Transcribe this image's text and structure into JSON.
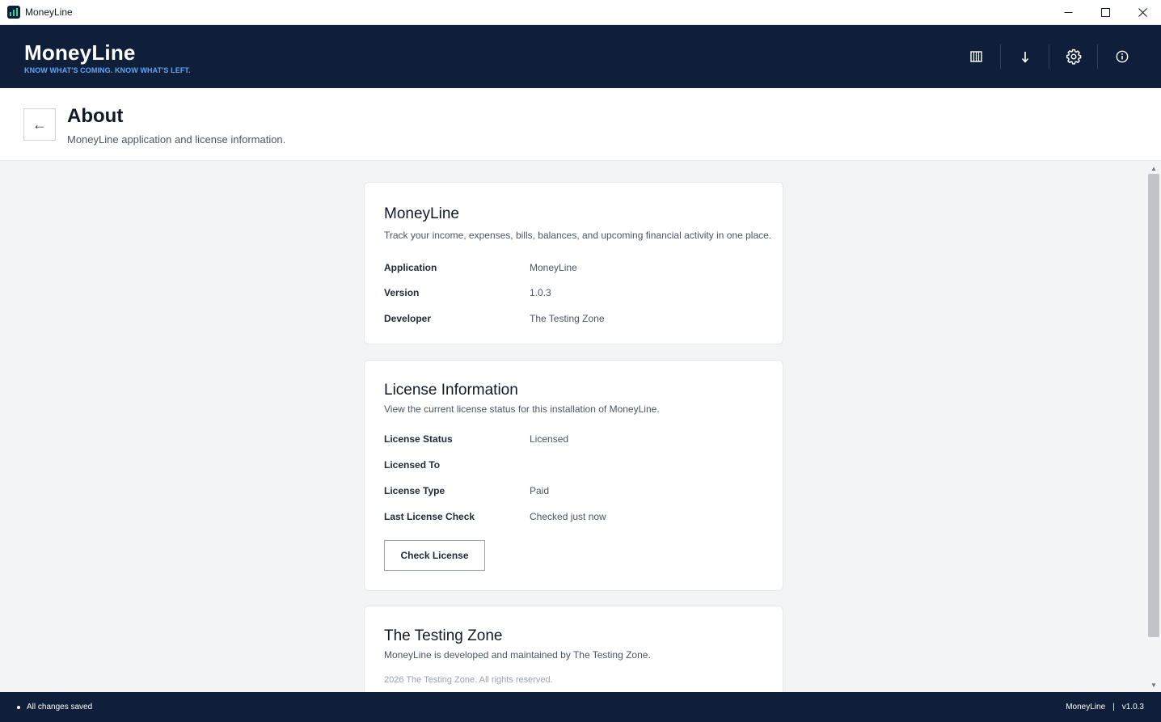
{
  "window": {
    "title": "MoneyLine",
    "controls": {
      "minimize": "—",
      "maximize": "☐",
      "close": "✕"
    }
  },
  "header": {
    "brand_name": "MoneyLine",
    "tagline": "KNOW WHAT'S COMING. KNOW WHAT'S LEFT.",
    "actions": [
      {
        "icon": "columns-icon"
      },
      {
        "icon": "download-icon"
      },
      {
        "icon": "gear-icon"
      },
      {
        "icon": "info-icon"
      }
    ]
  },
  "page": {
    "back_icon": "←",
    "title": "About",
    "subtitle": "MoneyLine application and license information."
  },
  "app_card": {
    "title": "MoneyLine",
    "description": "Track your income, expenses, bills, balances, and upcoming financial activity in one place.",
    "rows": [
      {
        "label": "Application",
        "value": "MoneyLine"
      },
      {
        "label": "Version",
        "value": "1.0.3"
      },
      {
        "label": "Developer",
        "value": "The Testing Zone"
      }
    ]
  },
  "license_card": {
    "title": "License Information",
    "description": "View the current license status for this installation of MoneyLine.",
    "rows": [
      {
        "label": "License Status",
        "value": "Licensed"
      },
      {
        "label": "Licensed To",
        "value": ""
      },
      {
        "label": "License Type",
        "value": "Paid"
      },
      {
        "label": "Last License Check",
        "value": "Checked just now"
      }
    ],
    "check_button": "Check License"
  },
  "company_card": {
    "title": "The Testing Zone",
    "description": "MoneyLine is developed and maintained by The Testing Zone.",
    "copyright": "2026 The Testing Zone. All rights reserved."
  },
  "statusbar": {
    "status": "All changes saved",
    "app_name": "MoneyLine",
    "separator": "|",
    "version": "v1.0.3"
  },
  "colors": {
    "header_bg": "#0f1f3a",
    "accent": "#60a5fa",
    "page_bg": "#f3f4f6"
  }
}
